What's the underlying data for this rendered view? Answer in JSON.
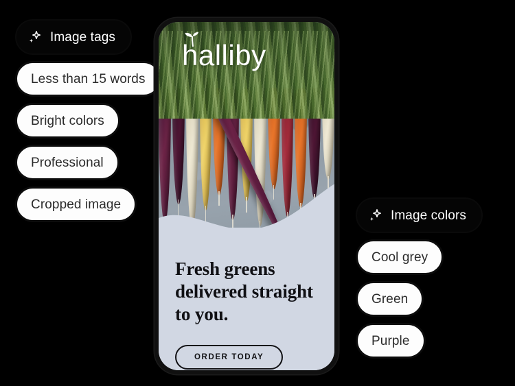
{
  "background_color": "#000000",
  "panels": {
    "image_tags": {
      "header": {
        "label": "Image tags",
        "icon": "sparkle-icon",
        "bg": "#050505",
        "fg": "#ffffff"
      },
      "items": [
        {
          "label": "Less than 15 words"
        },
        {
          "label": "Bright colors"
        },
        {
          "label": "Professional"
        },
        {
          "label": "Cropped image"
        }
      ]
    },
    "image_colors": {
      "header": {
        "label": "Image colors",
        "icon": "sparkle-icon",
        "bg": "#050505",
        "fg": "#ffffff"
      },
      "items": [
        {
          "label": "Cool grey"
        },
        {
          "label": "Green"
        },
        {
          "label": "Purple"
        }
      ]
    }
  },
  "phone_mockup": {
    "frame_color": "#101010",
    "brand": {
      "wordmark": "halliby",
      "icon": "leaf-sprout-icon",
      "color": "#ffffff"
    },
    "photo": {
      "subject": "multicolored carrots on grey slate",
      "icon": "carrots-photo",
      "colors": [
        "#98a3ad",
        "#6d2447",
        "#efe9d4",
        "#f0d469",
        "#e8752a",
        "#4a6d2c"
      ]
    },
    "panel_color": "#d1d7e3",
    "headline": "Fresh greens delivered straight to you.",
    "cta": {
      "label": "ORDER TODAY",
      "border_color": "#111114"
    }
  }
}
